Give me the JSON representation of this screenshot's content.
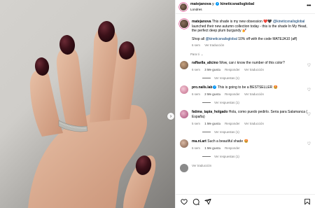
{
  "header": {
    "user": "matejanova",
    "joiner": "y",
    "collab": "kineticsnailsglobal",
    "location": "Londres"
  },
  "caption": {
    "user": "matejanova",
    "text_1": "This shade is my new obsession",
    "emoji_1": "❤️🖤",
    "mention_1": "@kineticsnailsglobal",
    "text_2": "launched their new autumn collection today - this is the shade In My Head, the perfect deep plum burgundy",
    "emoji_2": "💅",
    "text_3": "Shop all",
    "mention_2": "@kineticsnailsglobal",
    "text_4": "10% off with the code MATEJA10 (aff)",
    "time": "6 sem",
    "translate": "Ver traducción"
  },
  "separator_label": "Para ti",
  "comments": [
    {
      "user": "raffaella_alicino",
      "verified": false,
      "text": "Wow, can i know the number of this color?",
      "time": "6 sem",
      "likes": "3 Me gusta",
      "reply": "Responder",
      "translate": "Ver traducción",
      "replies": "Ver respuestas (1)"
    },
    {
      "user": "pro.nails.lab",
      "verified": true,
      "text": "This is going to be a BESTSELLER 🤩",
      "time": "6 sem",
      "likes": "2 Me gusta",
      "reply": "Responder",
      "translate": "Ver traducción",
      "replies": "Ver respuestas (1)"
    },
    {
      "user": "fatima_tapia_holgado",
      "verified": false,
      "text": "Hola, como puedo pedirlo. Seria para Salamanca ( España)",
      "time": "5 sem",
      "likes": "1 Me gusta",
      "reply": "Responder",
      "translate": "Ver traducción",
      "replies": "Ver respuestas (1)"
    },
    {
      "user": "ma.ni.art",
      "verified": false,
      "text": "Such a beautiful shade 🤩",
      "time": "6 sem",
      "likes": "1 Me gusta",
      "reply": "Responder",
      "translate": "",
      "replies": "Ver respuestas (1)"
    }
  ],
  "partial": {
    "translate": "Ver traducción"
  },
  "icons": {
    "more": "more-horizontal-icon",
    "heart": "heart-icon",
    "comment": "comment-icon",
    "share": "share-icon",
    "bookmark": "bookmark-icon",
    "next": "chevron-right-icon"
  },
  "colors": {
    "link": "#00376b",
    "verified": "#0095f6",
    "nail": "#3b1119"
  }
}
